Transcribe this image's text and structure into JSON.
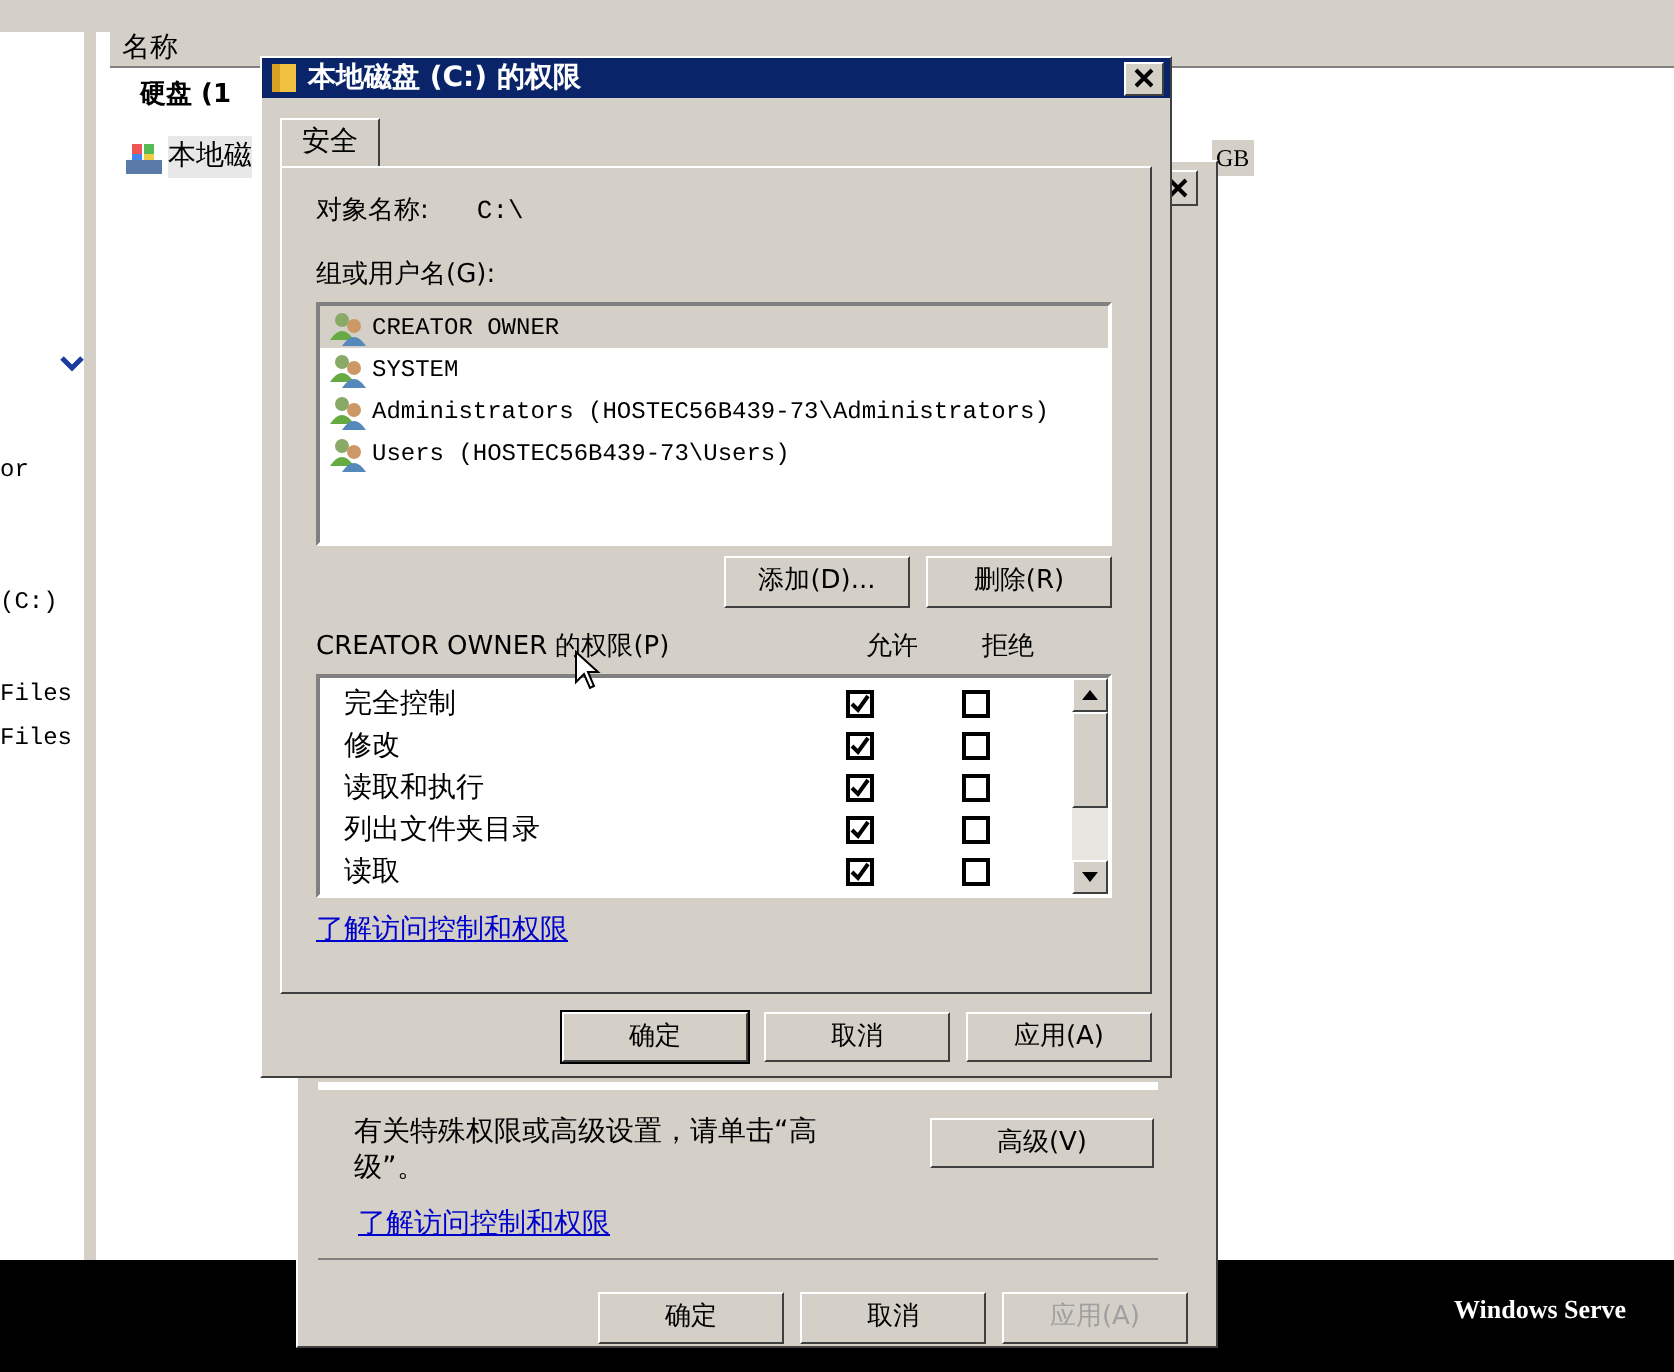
{
  "explorer": {
    "left_pane": [
      "or",
      "(C:)",
      "Files",
      "Files"
    ],
    "columns": [
      "名称"
    ],
    "group_header": "硬盘 (1",
    "drive": {
      "name": "本地磁",
      "size": "GB"
    }
  },
  "back_dialog": {
    "note": "有关特殊权限或高级设置，请单击“高级”。",
    "advanced_button": "高级(V)",
    "link": "了解访问控制和权限",
    "buttons": [
      {
        "label": "确定",
        "disabled": false
      },
      {
        "label": "取消",
        "disabled": false
      },
      {
        "label": "应用(A)",
        "disabled": true
      }
    ]
  },
  "dialog": {
    "title": "本地磁盘 (C:) 的权限",
    "tabs": [
      {
        "label": "安全",
        "selected": true
      }
    ],
    "object_label": "对象名称:",
    "object_value": "C:\\",
    "groups_label": "组或用户名(G):",
    "users": [
      {
        "name": "CREATOR OWNER",
        "selected": true
      },
      {
        "name": "SYSTEM",
        "selected": false
      },
      {
        "name": "Administrators (HOSTEC56B439-73\\Administrators)",
        "selected": false
      },
      {
        "name": "Users (HOSTEC56B439-73\\Users)",
        "selected": false
      }
    ],
    "user_buttons": [
      "添加(D)...",
      "删除(R)"
    ],
    "permissions_label": "CREATOR OWNER 的权限(P)",
    "allow_header": "允许",
    "deny_header": "拒绝",
    "permissions": [
      {
        "name": "完全控制",
        "allow": true,
        "deny": false
      },
      {
        "name": "修改",
        "allow": true,
        "deny": false
      },
      {
        "name": "读取和执行",
        "allow": true,
        "deny": false
      },
      {
        "name": "列出文件夹目录",
        "allow": true,
        "deny": false
      },
      {
        "name": "读取",
        "allow": true,
        "deny": false
      }
    ],
    "link": "了解访问控制和权限",
    "buttons": [
      {
        "label": "确定",
        "default": true,
        "disabled": false
      },
      {
        "label": "取消",
        "default": false,
        "disabled": false
      },
      {
        "label": "应用(A)",
        "default": false,
        "disabled": false
      }
    ]
  },
  "taskbar": {
    "text": "Windows Serve"
  }
}
